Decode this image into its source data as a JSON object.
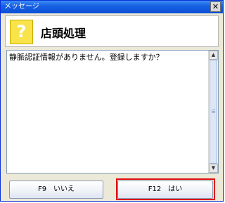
{
  "window": {
    "title": "メッセージ",
    "close_glyph": "✕"
  },
  "header": {
    "icon_glyph": "?",
    "caption": "店頭処理"
  },
  "message": {
    "text": "静脈認証情報がありません。登録しますか？"
  },
  "buttons": {
    "no_label": "F9　いいえ",
    "yes_label": "F12　はい"
  },
  "colors": {
    "titlebar": "#1761e3",
    "dialog_bg": "#ece9d8",
    "icon_yellow": "#f8e34a",
    "highlight": "#e01010"
  }
}
